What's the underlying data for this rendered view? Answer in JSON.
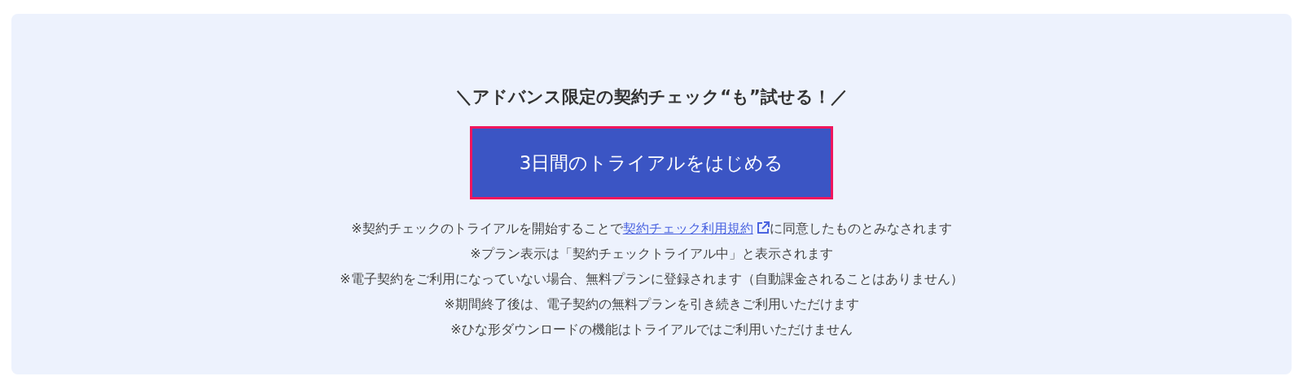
{
  "headline": "＼アドバンス限定の契約チェック“も”試せる！／",
  "button": {
    "label": "3日間のトライアルをはじめる",
    "highlighted": true
  },
  "notes": [
    {
      "before": "※契約チェックのトライアルを開始することで",
      "link": "契約チェック利用規約",
      "after": "に同意したものとみなされます"
    },
    {
      "before": "※プラン表示は「契約チェックトライアル中」と表示されます"
    },
    {
      "before": "※電子契約をご利用になっていない場合、無料プランに登録されます（自動課金されることはありません）"
    },
    {
      "before": "※期間終了後は、電子契約の無料プランを引き続きご利用いただけます"
    },
    {
      "before": "※ひな形ダウンロードの機能はトライアルではご利用いただけません"
    }
  ]
}
